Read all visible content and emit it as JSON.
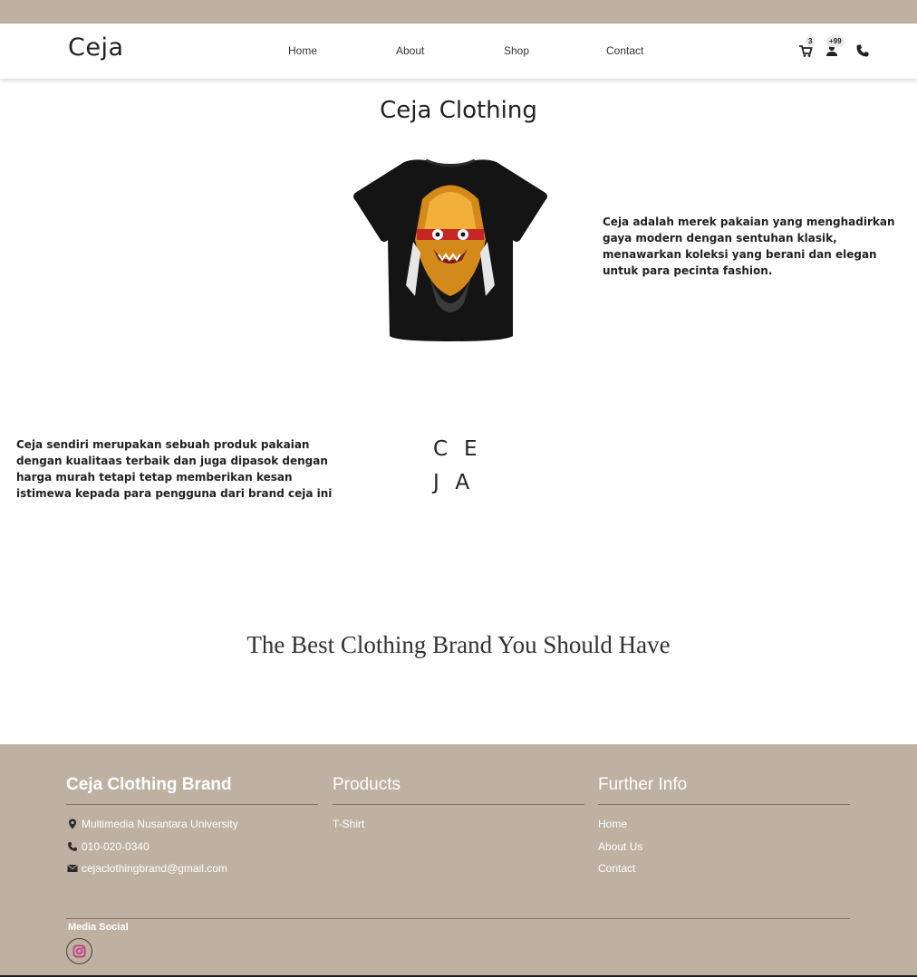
{
  "nav": {
    "logo": "Ceja",
    "links": [
      "Home",
      "About",
      "Shop",
      "Contact"
    ],
    "cart_badge": "3",
    "user_badge": "+99"
  },
  "main": {
    "title": "Ceja Clothing",
    "intro": "Ceja adalah merek pakaian yang menghadirkan gaya modern dengan sentuhan klasik, menawarkan koleksi yang berani dan elegan untuk para pecinta fashion.",
    "description": "Ceja sendiri merupakan sebuah produk pakaian dengan kualitaas terbaik dan juga dipasok dengan harga murah tetapi tetap memberikan kesan istimewa kepada para pengguna dari brand ceja ini",
    "logo_line1": "CE",
    "logo_line2": "JA",
    "tagline": "The Best Clothing Brand You Should Have"
  },
  "footer": {
    "brand_title": "Ceja Clothing Brand",
    "address": "Multimedia Nusantara University",
    "phone": "010-020-0340",
    "email": "cejaclothingbrand@gmail.com",
    "products_title": "Products",
    "products": [
      "T-Shirt"
    ],
    "info_title": "Further Info",
    "info_links": [
      "Home",
      "About Us",
      "Contact"
    ],
    "social_title": "Media Social"
  },
  "colors": {
    "beige": "#bfb1a2",
    "instagram": "#c13584"
  },
  "icons": [
    "cart-icon",
    "user-icon",
    "phone-icon",
    "location-icon",
    "email-icon",
    "instagram-icon"
  ]
}
